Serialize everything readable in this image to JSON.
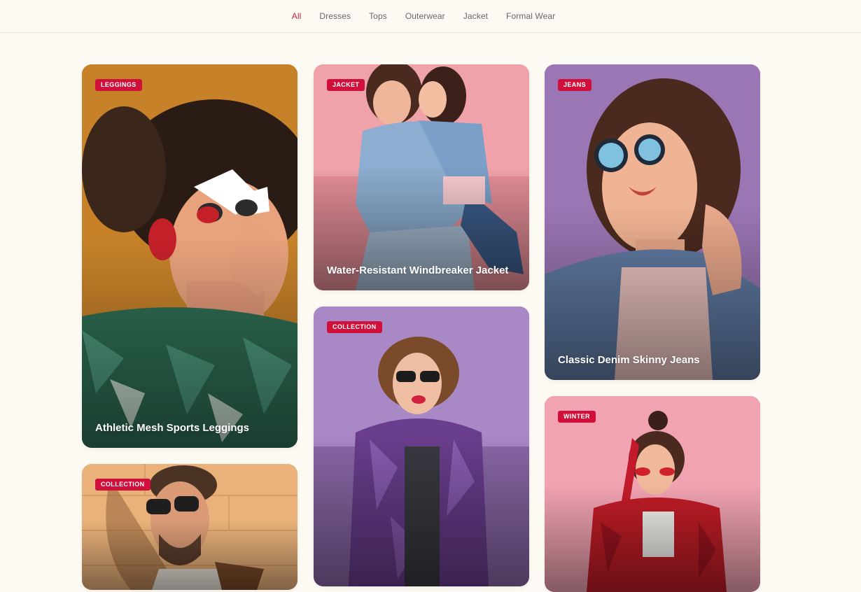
{
  "nav": {
    "items": [
      {
        "label": "All",
        "active": true
      },
      {
        "label": "Dresses",
        "active": false
      },
      {
        "label": "Tops",
        "active": false
      },
      {
        "label": "Outerwear",
        "active": false
      },
      {
        "label": "Jacket",
        "active": false
      },
      {
        "label": "Formal Wear",
        "active": false
      }
    ]
  },
  "cards": [
    {
      "badge": "LEGGINGS",
      "title": "Athletic Mesh Sports Leggings",
      "bg": "#d08a2e"
    },
    {
      "badge": "JACKET",
      "title": "Water-Resistant Windbreaker Jacket",
      "bg": "#f0a2aa"
    },
    {
      "badge": "JEANS",
      "title": "Classic Denim Skinny Jeans",
      "bg": "#9b76b4"
    },
    {
      "badge": "COLLECTION",
      "title": "",
      "bg": "#a988c6"
    },
    {
      "badge": "COLLECTION",
      "title": "",
      "bg": "#eab27a"
    },
    {
      "badge": "WINTER",
      "title": "",
      "bg": "#f2a3b2"
    }
  ],
  "colors": {
    "accent": "#c8264a",
    "badge": "#d0103a",
    "page_bg": "#fdf9f3"
  }
}
